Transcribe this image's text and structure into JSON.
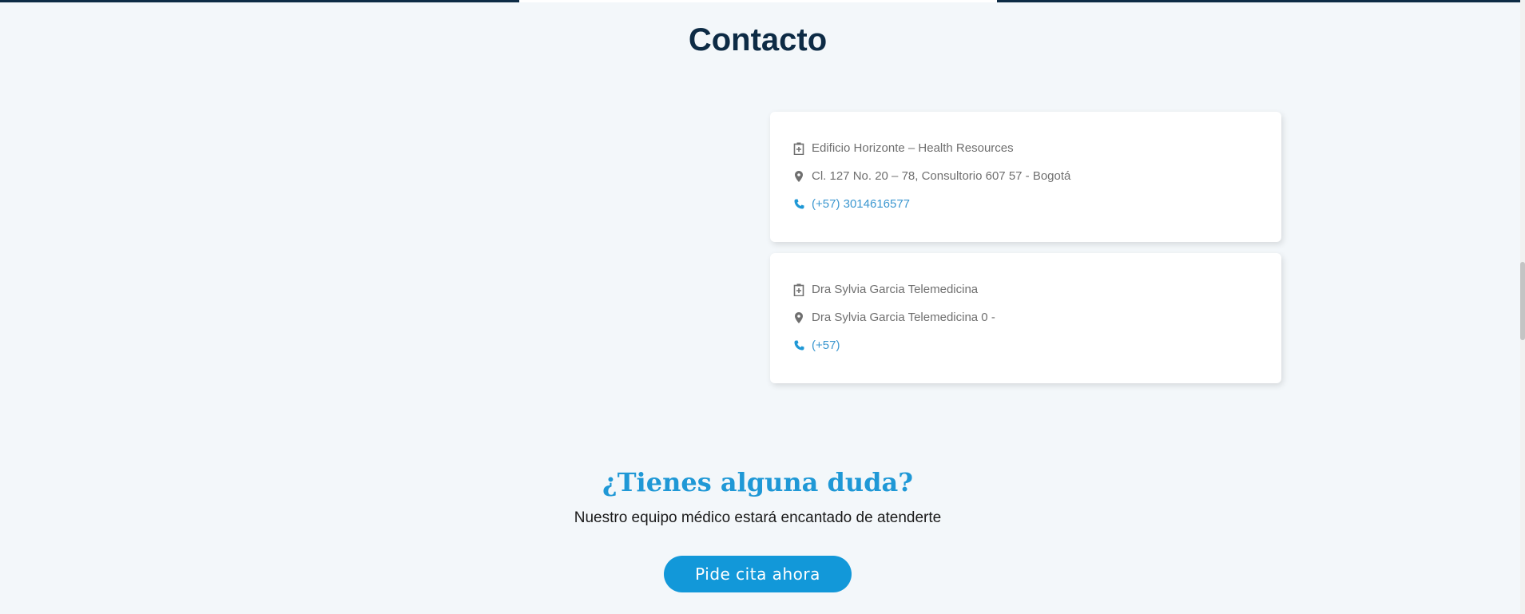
{
  "section": {
    "title": "Contacto"
  },
  "locations": [
    {
      "name": "Edificio Horizonte – Health Resources",
      "address": "Cl. 127 No. 20 – 78, Consultorio 607 57 - Bogotá",
      "phone": "(+57) 3014616577",
      "icons": {
        "name": "clinic-icon",
        "address": "map-marker-icon",
        "phone": "phone-icon"
      }
    },
    {
      "name": "Dra Sylvia Garcia Telemedicina",
      "address": "Dra Sylvia Garcia Telemedicina 0 -",
      "phone": "(+57)",
      "icons": {
        "name": "clinic-icon",
        "address": "map-marker-icon",
        "phone": "phone-icon"
      }
    }
  ],
  "cta": {
    "heading": "¿Tienes alguna duda?",
    "subtitle": "Nuestro equipo médico estará encantado de atenderte",
    "button_label": "Pide cita ahora"
  },
  "colors": {
    "background": "#f3f7fa",
    "title": "#0d2b45",
    "accent": "#1f98d6",
    "button": "#1298d9",
    "link": "#3b97d0",
    "muted_text": "#6f6f6f"
  }
}
